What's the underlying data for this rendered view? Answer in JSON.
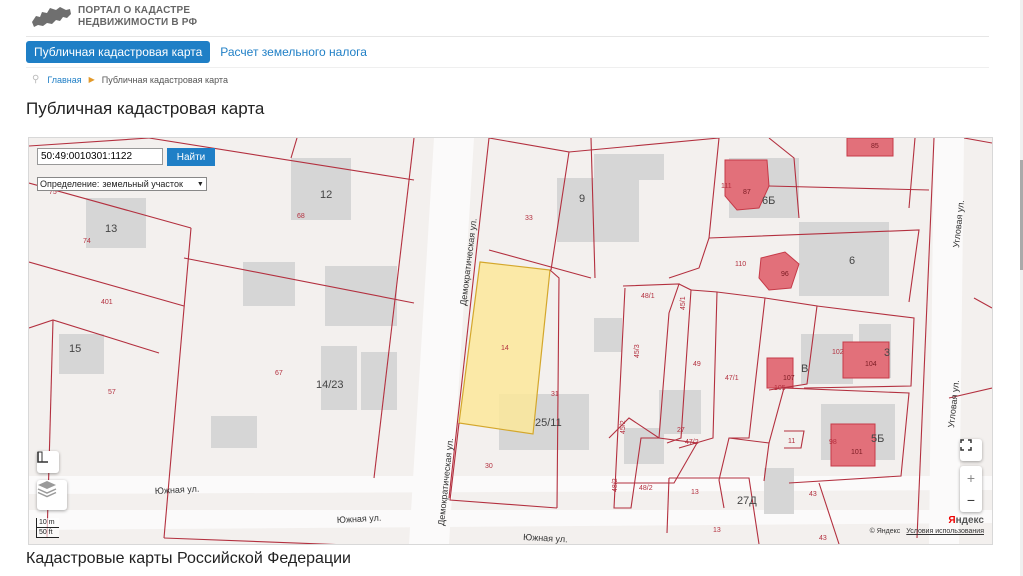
{
  "header": {
    "logo_line1": "ПОРТАЛ О КАДАСТРЕ",
    "logo_line2": "НЕДВИЖИМОСТИ В РФ"
  },
  "nav": {
    "active": "Публичная кадастровая карта",
    "link": "Расчет земельного налога"
  },
  "breadcrumb": {
    "home": "Главная",
    "current": "Публичная кадастровая карта"
  },
  "page_title": "Публичная кадастровая карта",
  "map": {
    "search_value": "50:49:0010301:1122",
    "search_button": "Найти",
    "definition_label": "Определение:",
    "definition_value": "земельный участок",
    "scale_m": "10 m",
    "scale_ft": "50 ft",
    "copyright": "© Яндекс",
    "terms": "Условия использования",
    "yandex_logo_y": "Я",
    "yandex_logo_rest": "ндекс",
    "zoom_in": "+",
    "zoom_out": "−",
    "accent": "#1f7fc6",
    "parcel_stroke": "#b3303f",
    "selected_fill": "#fbe89a",
    "labels": {
      "street_dem1": "Демократическая ул.",
      "street_dem2": "Демократическая ул.",
      "street_south1": "Южная ул.",
      "street_south2": "Южная ул.",
      "street_south3": "Южная ул.",
      "street_corner": "Угловая ул.",
      "b12": "12",
      "b13": "13",
      "b15": "15",
      "b1423": "14/23",
      "b9": "9",
      "b2511": "25/11",
      "b6b": "6Б",
      "b6": "6",
      "b3": "3",
      "bB": "В",
      "b5b": "5Б",
      "b27d": "27Д",
      "p68": "68",
      "p74": "74",
      "p75": "75",
      "p401": "401",
      "p57": "57",
      "p67": "67",
      "p33": "33",
      "p14": "14",
      "p31": "31",
      "p30": "30",
      "p481": "48/1",
      "p451": "45/1",
      "p453": "45/3",
      "p49": "49",
      "p471": "47/1",
      "p452": "45/2",
      "p27": "27",
      "p472": "47/2",
      "p482": "48/2",
      "p482b": "48/2",
      "p13a": "13",
      "p13b": "13",
      "p43a": "43",
      "p43b": "43",
      "p111": "111",
      "p87": "87",
      "p110": "110",
      "p96": "96",
      "p102": "102",
      "p104": "104",
      "p107": "107",
      "p105": "105",
      "p11": "11",
      "p98": "98",
      "p101": "101",
      "p85": "85"
    }
  }
}
